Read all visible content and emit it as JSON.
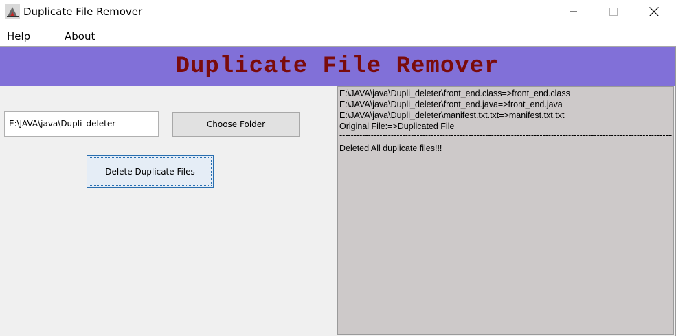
{
  "window": {
    "title": "Duplicate File Remover",
    "icons": {
      "app": "app-icon",
      "minimize": "minimize-icon",
      "maximize": "maximize-icon",
      "close": "close-icon"
    }
  },
  "menu": {
    "items": [
      {
        "label": "Help"
      },
      {
        "label": "About"
      }
    ]
  },
  "banner": {
    "title": "Duplicate File Remover",
    "background": "#8170d8",
    "text_color": "#7a0b0b"
  },
  "form": {
    "folder_path": "E:\\JAVA\\java\\Dupli_deleter",
    "choose_label": "Choose Folder",
    "delete_label": "Delete Duplicate Files"
  },
  "output": {
    "lines": [
      "E:\\JAVA\\java\\Dupli_deleter\\front_end.class=>front_end.class",
      "E:\\JAVA\\java\\Dupli_deleter\\front_end.java=>front_end.java",
      "E:\\JAVA\\java\\Dupli_deleter\\manifest.txt.txt=>manifest.txt.txt",
      "Original File:=>Duplicated File"
    ],
    "separator": "------------------------------------------------------------------------------------------------------------------------",
    "status": "Deleted All duplicate files!!!",
    "background": "#cdc9c9"
  }
}
